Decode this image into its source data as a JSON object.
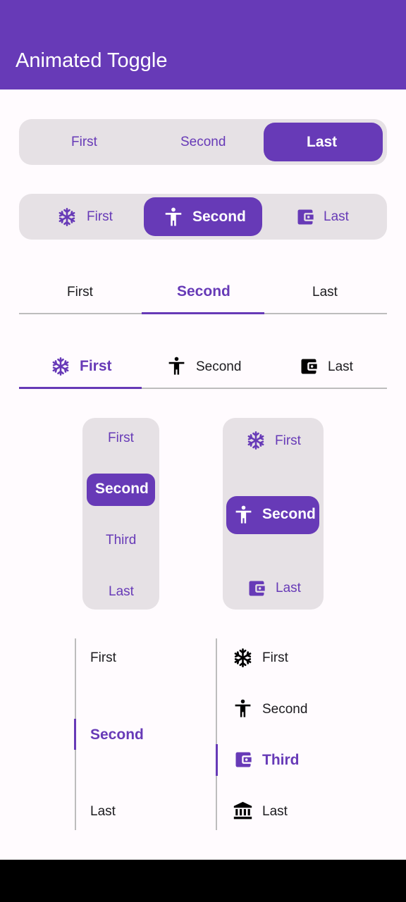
{
  "app": {
    "title": "Animated Toggle"
  },
  "colors": {
    "primary": "#673ab7",
    "surface": "#e6e1e5",
    "text": "#1c1b1f",
    "divider": "#bdbdbd"
  },
  "toggle1": {
    "items": [
      "First",
      "Second",
      "Last"
    ],
    "selected": "Last"
  },
  "toggle2": {
    "items": [
      {
        "label": "First",
        "icon": "snowflake-icon"
      },
      {
        "label": "Second",
        "icon": "accessibility-icon"
      },
      {
        "label": "Last",
        "icon": "wallet-icon"
      }
    ],
    "selected": "Second"
  },
  "tabs1": {
    "items": [
      "First",
      "Second",
      "Last"
    ],
    "selected": "Second"
  },
  "tabs2": {
    "items": [
      {
        "label": "First",
        "icon": "snowflake-icon"
      },
      {
        "label": "Second",
        "icon": "accessibility-icon"
      },
      {
        "label": "Last",
        "icon": "wallet-icon"
      }
    ],
    "selected": "First"
  },
  "vtoggle1": {
    "items": [
      "First",
      "Second",
      "Third",
      "Last"
    ],
    "selected": "Second"
  },
  "vtoggle2": {
    "items": [
      {
        "label": "First",
        "icon": "snowflake-icon"
      },
      {
        "label": "Second",
        "icon": "accessibility-icon"
      },
      {
        "label": "Last",
        "icon": "wallet-icon"
      }
    ],
    "selected": "Second"
  },
  "vtabs1": {
    "items": [
      "First",
      "Second",
      "Last"
    ],
    "selected": "Second"
  },
  "vtabs2": {
    "items": [
      {
        "label": "First",
        "icon": "snowflake-icon"
      },
      {
        "label": "Second",
        "icon": "accessibility-icon"
      },
      {
        "label": "Third",
        "icon": "wallet-icon"
      },
      {
        "label": "Last",
        "icon": "bank-icon"
      }
    ],
    "selected": "Third"
  }
}
